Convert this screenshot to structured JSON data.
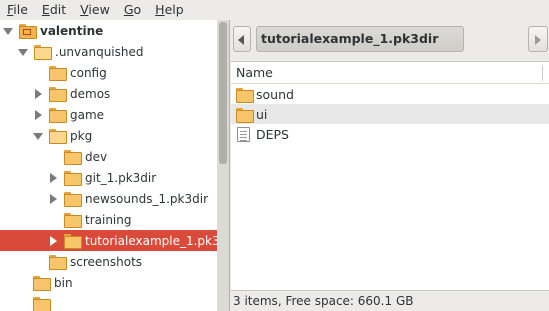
{
  "menubar": {
    "file": {
      "ul": "F",
      "rest": "ile"
    },
    "edit": {
      "ul": "E",
      "rest": "dit"
    },
    "view": {
      "ul": "V",
      "rest": "iew"
    },
    "go": {
      "ul": "G",
      "rest": "o"
    },
    "help": {
      "ul": "H",
      "rest": "elp"
    }
  },
  "tree": {
    "items": [
      {
        "label": "valentine"
      },
      {
        "label": ".unvanquished"
      },
      {
        "label": "config"
      },
      {
        "label": "demos"
      },
      {
        "label": "game"
      },
      {
        "label": "pkg"
      },
      {
        "label": "dev"
      },
      {
        "label": "git_1.pk3dir"
      },
      {
        "label": "newsounds_1.pk3dir"
      },
      {
        "label": "training"
      },
      {
        "label": "tutorialexample_1.pk3dir"
      },
      {
        "label": "screenshots"
      },
      {
        "label": "bin"
      }
    ]
  },
  "pathbar": {
    "current": "tutorialexample_1.pk3dir"
  },
  "filelist": {
    "column_name": "Name",
    "items": [
      {
        "label": "sound",
        "icon": "folder-icon"
      },
      {
        "label": "ui",
        "icon": "folder-icon"
      },
      {
        "label": "DEPS",
        "icon": "text-file-icon"
      }
    ]
  },
  "status": "3 items, Free space: 660.1 GB",
  "colors": {
    "selection": "#d94a3a",
    "folder": "#f7c56a",
    "background": "#ecebe9"
  }
}
